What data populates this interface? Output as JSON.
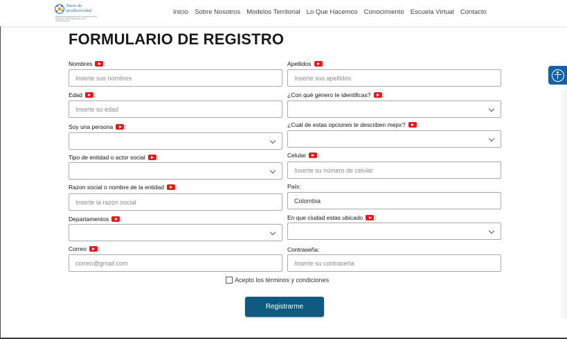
{
  "header": {
    "logo_text_line1": "Pacto de",
    "logo_text_line2": "productividad",
    "logo_subtext": "PROGRAMA EMPRESARIAL DE PROMOCIÓN LABORAL PARA PERSONAS CON DISCAPACIDAD",
    "nav": [
      "Inicio",
      "Sobre Nosotros",
      "Modelos Territorial",
      "Lo Que Hacemos",
      "Conocimiento",
      "Escuela Virtual",
      "Contacto"
    ]
  },
  "form": {
    "title": "FORMULARIO DE REGISTRO",
    "fields": {
      "nombres": {
        "label": "Nombres",
        "placeholder": "Inserte sus nombres"
      },
      "apellidos": {
        "label": "Apellidos",
        "placeholder": "Inserte sus apellidos"
      },
      "edad": {
        "label": "Edad",
        "placeholder": "Inserte su edad"
      },
      "genero": {
        "label": "¿Con qué género te identificas?",
        "value": ""
      },
      "persona": {
        "label": "Soy una persona",
        "value": ""
      },
      "opciones": {
        "label": "¿Cuál de estas opciones te describen mejor?",
        "value": ""
      },
      "entidad": {
        "label": "Tipo de entidad o actor social",
        "value": ""
      },
      "celular": {
        "label": "Celular",
        "placeholder": "Inserte su número de celular"
      },
      "razon": {
        "label": "Razon social o nombre de la entidad",
        "placeholder": "Inserte la razón social"
      },
      "pais": {
        "label": "País:",
        "value": "Colombia"
      },
      "departamentos": {
        "label": "Departamentos",
        "value": ""
      },
      "ciudad": {
        "label": "En que ciudad estas ubicado",
        "value": ""
      },
      "correo": {
        "label": "Correo",
        "placeholder": "correo@gmail.com"
      },
      "contrasena": {
        "label": "Contraseña:",
        "placeholder": "Inserte su contraseña"
      }
    },
    "terms_label": "Acepto los términos y condiciones",
    "terms_checked": false,
    "submit_label": "Registrarme"
  },
  "colors": {
    "accent": "#0f5a7f",
    "youtube_red": "#e21b1b",
    "accessibility_blue": "#1461a8"
  }
}
